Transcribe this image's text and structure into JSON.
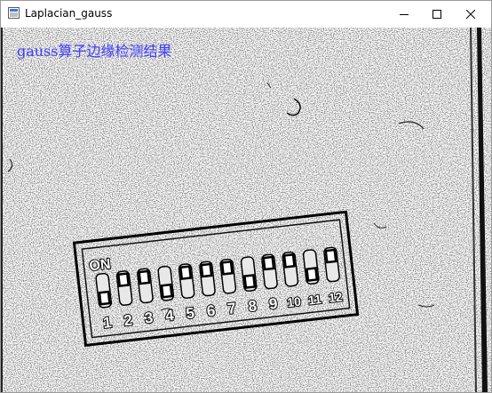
{
  "window": {
    "title": "Laplacian_gauss",
    "icon": "app-window-icon"
  },
  "controls": {
    "minimize_icon": "minimize-icon",
    "maximize_icon": "maximize-icon",
    "close_icon": "close-icon"
  },
  "canvas": {
    "overlay_text": "gauss算子边缘检测结果",
    "overlay_color": "#4040ff",
    "switch_on_label": "ON",
    "switch_numbers": [
      "1",
      "2",
      "3",
      "4",
      "5",
      "6",
      "7",
      "8",
      "9",
      "10",
      "11",
      "12"
    ]
  }
}
